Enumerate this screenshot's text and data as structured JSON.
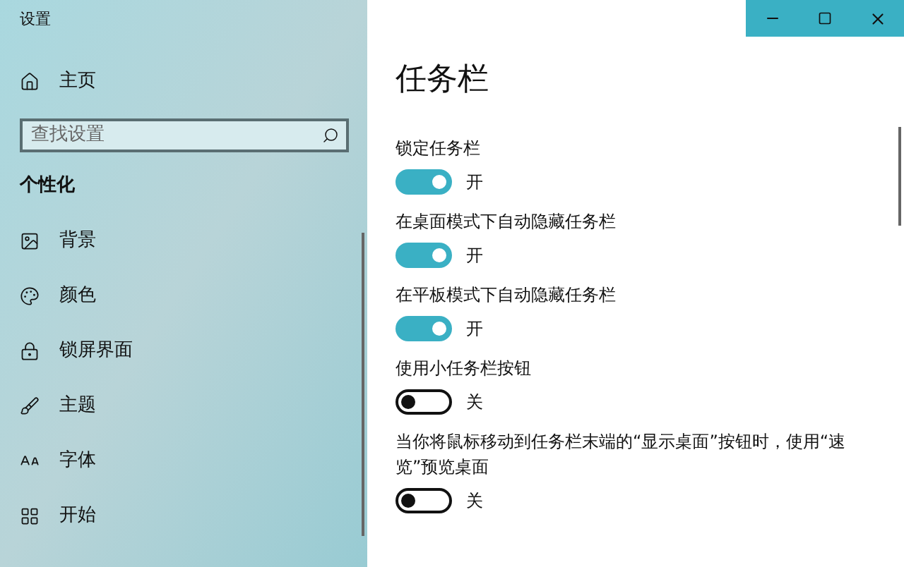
{
  "window": {
    "title": "设置"
  },
  "sidebar": {
    "home": "主页",
    "search": {
      "placeholder": "查找设置"
    },
    "section": "个性化",
    "items": [
      {
        "label": "背景"
      },
      {
        "label": "颜色"
      },
      {
        "label": "锁屏界面"
      },
      {
        "label": "主题"
      },
      {
        "label": "字体"
      },
      {
        "label": "开始"
      }
    ]
  },
  "page": {
    "title": "任务栏",
    "settings": [
      {
        "label": "锁定任务栏",
        "on": true,
        "state_label": "开"
      },
      {
        "label": "在桌面模式下自动隐藏任务栏",
        "on": true,
        "state_label": "开"
      },
      {
        "label": "在平板模式下自动隐藏任务栏",
        "on": true,
        "state_label": "开"
      },
      {
        "label": "使用小任务栏按钮",
        "on": false,
        "state_label": "关"
      },
      {
        "label": "当你将鼠标移动到任务栏末端的“显示桌面”按钮时，使用“速览”预览桌面",
        "on": false,
        "state_label": "关"
      }
    ]
  }
}
